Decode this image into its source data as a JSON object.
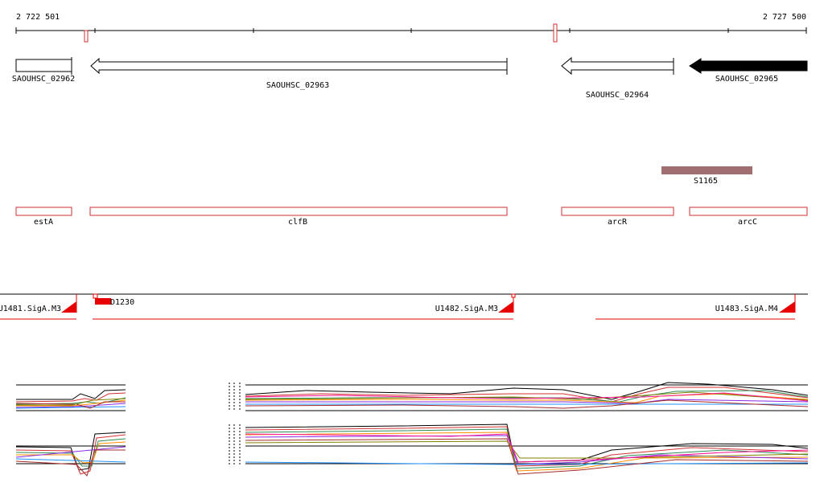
{
  "ruler": {
    "start_label": "2 722 501",
    "end_label": "2 727 500"
  },
  "genes": [
    {
      "label": "SAOUHSC_02962",
      "filled": false,
      "strand": "+"
    },
    {
      "label": "SAOUHSC_02963",
      "filled": false,
      "strand": "-"
    },
    {
      "label": "SAOUHSC_02964",
      "filled": false,
      "strand": "-"
    },
    {
      "label": "SAOUHSC_02965",
      "filled": true,
      "strand": "-"
    }
  ],
  "feature_s1165": {
    "label": "S1165",
    "color": "#a06e6e"
  },
  "gene_names": [
    {
      "label": "estA"
    },
    {
      "label": "clfB"
    },
    {
      "label": "arcR"
    },
    {
      "label": "arcC"
    }
  ],
  "transcripts": [
    {
      "label": "U1481.SigA.M3"
    },
    {
      "label": "D1230"
    },
    {
      "label": "U1482.SigA.M3"
    },
    {
      "label": "U1483.SigA.M4"
    }
  ],
  "colors": {
    "feature_outline": "#d23232",
    "transcript": "#e60000",
    "gene_filled": "#000000"
  }
}
